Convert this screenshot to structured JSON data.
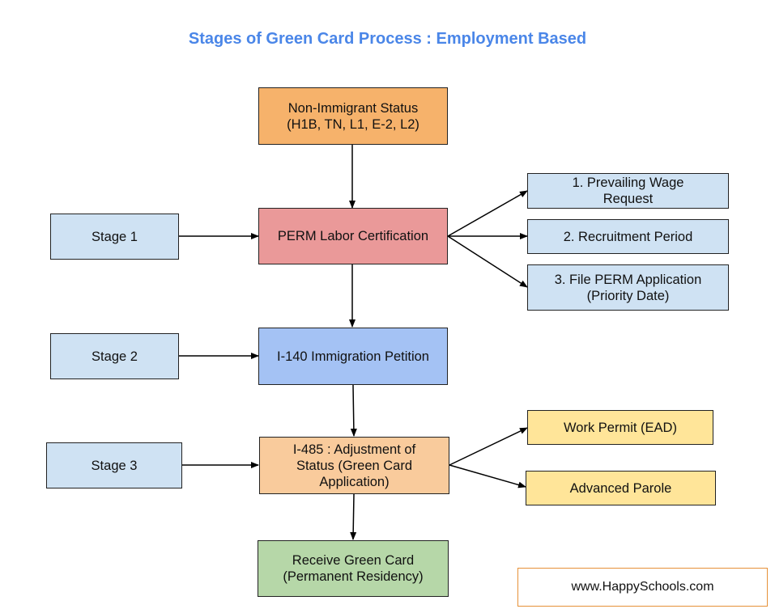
{
  "title": "Stages of Green Card Process : Employment Based",
  "colors": {
    "title": "#4a86e8",
    "stage_box": "#cfe2f3",
    "non_immigrant": "#f6b26b",
    "perm": "#ea9999",
    "i140": "#a4c2f4",
    "i485": "#f9cb9c",
    "benefits": "#ffe599",
    "green_card": "#b6d7a8",
    "watermark_border": "#e69138"
  },
  "nodes": {
    "non_immigrant": "Non-Immigrant Status\n(H1B, TN, L1, E-2, L2)",
    "perm": "PERM Labor Certification",
    "i140": "I-140 Immigration Petition",
    "i485": "I-485 : Adjustment of\nStatus (Green Card\nApplication)",
    "green_card": "Receive Green Card\n(Permanent Residency)",
    "stage1": "Stage 1",
    "stage2": "Stage 2",
    "stage3": "Stage 3",
    "perm_step1": "1. Prevailing Wage\nRequest",
    "perm_step2": "2. Recruitment  Period",
    "perm_step3": "3. File PERM Application\n(Priority Date)",
    "work_permit": "Work Permit (EAD)",
    "advance_parole": "Advanced Parole"
  },
  "edges": [
    {
      "from": "non_immigrant",
      "to": "perm"
    },
    {
      "from": "perm",
      "to": "i140"
    },
    {
      "from": "i140",
      "to": "i485"
    },
    {
      "from": "i485",
      "to": "green_card"
    },
    {
      "from": "stage1",
      "to": "perm"
    },
    {
      "from": "stage2",
      "to": "i140"
    },
    {
      "from": "stage3",
      "to": "i485"
    },
    {
      "from": "perm",
      "to": "perm_step1"
    },
    {
      "from": "perm",
      "to": "perm_step2"
    },
    {
      "from": "perm",
      "to": "perm_step3"
    },
    {
      "from": "i485",
      "to": "work_permit"
    },
    {
      "from": "i485",
      "to": "advance_parole"
    }
  ],
  "watermark": "www.HappySchools.com"
}
